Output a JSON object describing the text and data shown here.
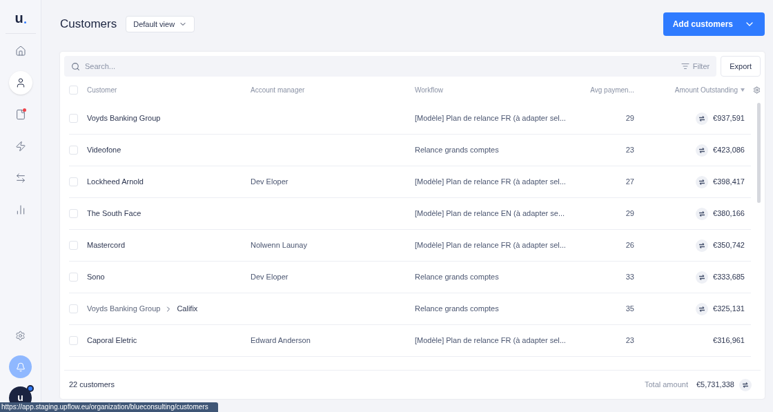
{
  "sidebar": {
    "logo": "u",
    "items": [
      {
        "kind": "home",
        "selected": false,
        "badge": false
      },
      {
        "kind": "user",
        "selected": true,
        "badge": false
      },
      {
        "kind": "file",
        "selected": false,
        "badge": true
      },
      {
        "kind": "zap",
        "selected": false,
        "badge": false
      },
      {
        "kind": "transfer",
        "selected": false,
        "badge": false
      },
      {
        "kind": "chart",
        "selected": false,
        "badge": false
      }
    ],
    "bottom": {
      "avatar": "u",
      "avatar_badge": true
    }
  },
  "header": {
    "title": "Customers",
    "view": "Default view",
    "add_button": "Add customers"
  },
  "toolbar": {
    "search_placeholder": "Search...",
    "filter": "Filter",
    "export": "Export"
  },
  "table": {
    "all_checked": false,
    "columns": [
      {
        "label": "Customer",
        "sorted": false
      },
      {
        "label": "Account manager",
        "sorted": false
      },
      {
        "label": "Workflow",
        "sorted": false
      },
      {
        "label": "Avg paymen...",
        "sorted": false
      },
      {
        "label": "Amount Outstanding",
        "sorted": true
      }
    ],
    "rows": [
      {
        "checked": false,
        "customer": "Voyds Banking Group",
        "account_manager": "",
        "workflow": "[Modèle] Plan de relance FR (à adapter sel...",
        "avg_payment": "29",
        "amount": "€937,591",
        "linked": true
      },
      {
        "checked": false,
        "customer": "Videofone",
        "account_manager": "",
        "workflow": "Relance grands comptes",
        "avg_payment": "23",
        "amount": "€423,086",
        "linked": true
      },
      {
        "checked": false,
        "customer": "Lockheed Arnold",
        "account_manager": "Dev Eloper",
        "workflow": "[Modèle] Plan de relance FR (à adapter sel...",
        "avg_payment": "27",
        "amount": "€398,417",
        "linked": true
      },
      {
        "checked": false,
        "customer": "The South Face",
        "account_manager": "",
        "workflow": "[Modèle] Plan de relance EN (à adapter se...",
        "avg_payment": "29",
        "amount": "€380,166",
        "linked": true
      },
      {
        "checked": false,
        "customer": "Mastercord",
        "account_manager": "Nolwenn Launay",
        "workflow": "[Modèle] Plan de relance FR (à adapter sel...",
        "avg_payment": "26",
        "amount": "€350,742",
        "linked": true
      },
      {
        "checked": false,
        "customer": "Sono",
        "account_manager": "Dev Eloper",
        "workflow": "Relance grands comptes",
        "avg_payment": "33",
        "amount": "€333,685",
        "linked": true
      },
      {
        "checked": false,
        "parent": "Voyds Banking Group",
        "customer": "Califix",
        "account_manager": "",
        "workflow": "Relance grands comptes",
        "avg_payment": "35",
        "amount": "€325,131",
        "linked": true
      },
      {
        "checked": false,
        "customer": "Caporal Eletric",
        "account_manager": "Edward Anderson",
        "workflow": "[Modèle] Plan de relance FR (à adapter sel...",
        "avg_payment": "23",
        "amount": "€316,961",
        "linked": false
      }
    ]
  },
  "footer": {
    "count": "22 customers",
    "total_label": "Total amount",
    "total": "€5,731,338",
    "linked": true
  },
  "status_url": "https://app.staging.upflow.eu/organization/blueconsulting/customers"
}
